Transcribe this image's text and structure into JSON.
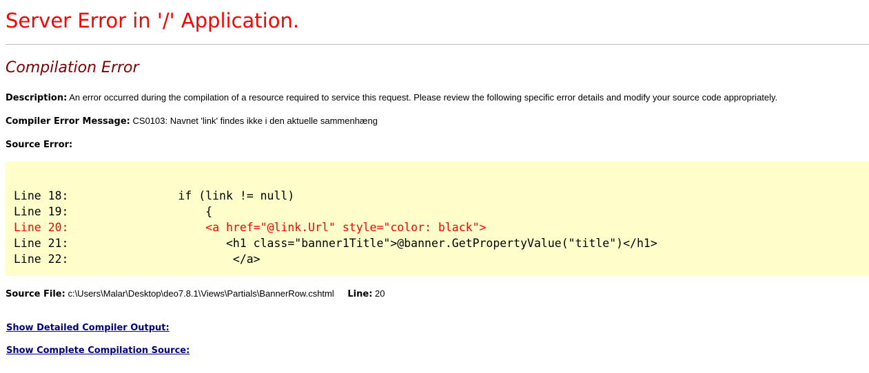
{
  "header": {
    "title": "Server Error in '/' Application.",
    "subtitle": "Compilation Error"
  },
  "description": {
    "label": "Description:",
    "text": "An error occurred during the compilation of a resource required to service this request. Please review the following specific error details and modify your source code appropriately."
  },
  "compiler_error": {
    "label": "Compiler Error Message:",
    "text": "CS0103: Navnet 'link' findes ikke i den aktuelle sammenhæng"
  },
  "source_error": {
    "label": "Source Error:",
    "lines": [
      {
        "text": "Line 18:                if (link != null)",
        "error": false
      },
      {
        "text": "Line 19:                    {",
        "error": false
      },
      {
        "text": "Line 20:                    <a href=\"@link.Url\" style=\"color: black\">",
        "error": true
      },
      {
        "text": "Line 21:                       <h1 class=\"banner1Title\">@banner.GetPropertyValue(\"title\")</h1>",
        "error": false
      },
      {
        "text": "Line 22:                        </a>",
        "error": false
      }
    ]
  },
  "source_file": {
    "label": "Source File:",
    "path": "c:\\Users\\Malar\\Desktop\\deo7.8.1\\Views\\Partials\\BannerRow.cshtml",
    "line_label": "Line:",
    "line_value": "20"
  },
  "links": {
    "detailed_output": "Show Detailed Compiler Output:",
    "complete_source": "Show Complete Compilation Source:"
  },
  "colors": {
    "title": "#ff0000",
    "subtitle": "#800000",
    "code_background": "#ffffcc",
    "error_line": "#ff0000",
    "link": "#000080"
  }
}
